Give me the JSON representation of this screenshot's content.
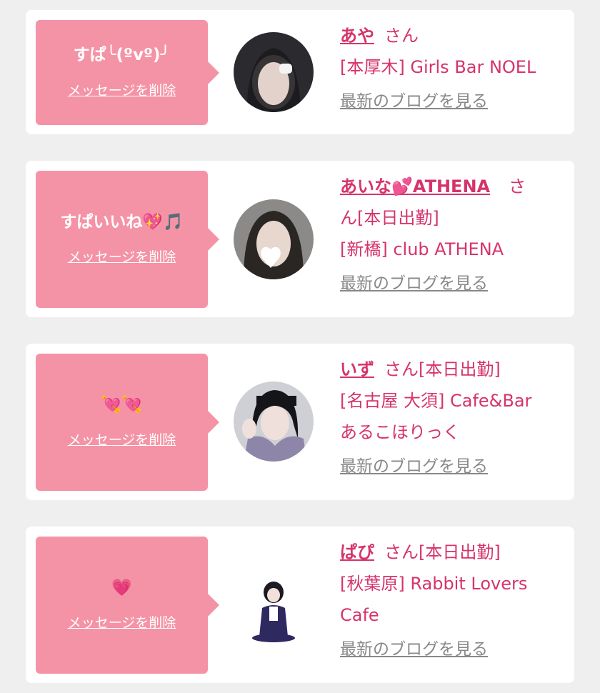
{
  "items": [
    {
      "message": "すぱ╰(ºvº)╯",
      "delete_label": "メッセージを削除",
      "name": "あや",
      "honorific": "さん",
      "status": "",
      "shop": "[本厚木] Girls Bar NOEL",
      "blog_label": "最新のブログを見る"
    },
    {
      "message": "すぱいいね💖🎵",
      "delete_label": "メッセージを削除",
      "name": "あいな💕ATHENA",
      "honorific": "さ",
      "honorific_cont": "ん",
      "status": "[本日出勤]",
      "shop": "[新橋] club ATHENA",
      "blog_label": "最新のブログを見る"
    },
    {
      "message": "💘💘",
      "delete_label": "メッセージを削除",
      "name": "いず",
      "honorific": "さん",
      "status": "[本日出勤]",
      "shop_line1": "[名古屋 大須] Cafe&Bar",
      "shop_line2": "あるこほりっく",
      "blog_label": "最新のブログを見る"
    },
    {
      "message": "💗",
      "delete_label": "メッセージを削除",
      "name": "ぱぴ",
      "honorific": "さん",
      "status": "[本日出勤]",
      "shop_line1": "[秋葉原] Rabbit Lovers",
      "shop_line2": "Cafe",
      "blog_label": "最新のブログを見る"
    }
  ],
  "colors": {
    "accent": "#d6336c",
    "bubble": "#f593a6",
    "link_gray": "#888888",
    "background": "#efefef"
  }
}
